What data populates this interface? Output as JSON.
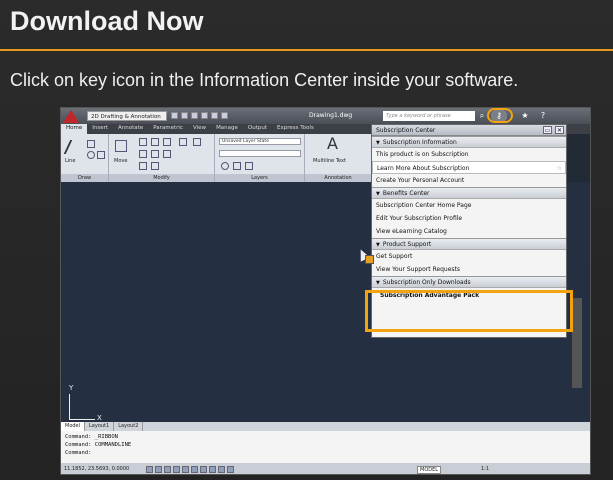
{
  "slide": {
    "title": "Download Now",
    "subtitle": "Click on key icon in the Information Center inside your software."
  },
  "autocad": {
    "workspace": "2D Drafting & Annotation",
    "document_title": "Drawing1.dwg",
    "search_placeholder": "Type a keyword or phrase",
    "tabs": [
      "Home",
      "Insert",
      "Annotate",
      "Parametric",
      "View",
      "Manage",
      "Output",
      "Express Tools"
    ],
    "active_tab": "Home",
    "ribbon": {
      "groups": [
        "Draw",
        "Modify",
        "Layers",
        "Annotation"
      ],
      "tools": [
        "Line",
        "Move"
      ],
      "layer_state": "Unsaved Layer State",
      "annotation_tool": "Multiline Text",
      "text_letter": "A"
    },
    "layout_tabs": [
      "Model",
      "Layout1",
      "Layout2"
    ],
    "command_lines": [
      "Command: _RIBBON",
      "Command: COMMANDLINE",
      "Command:"
    ],
    "status": {
      "coordinates": "11.1852, 23.5693, 0.0000",
      "model_label": "MODEL",
      "scale": "1:1"
    },
    "ucs": {
      "x": "X",
      "y": "Y"
    }
  },
  "subscription_center": {
    "title": "Subscription Center",
    "sections": [
      {
        "header": "Subscription Information",
        "items": [
          "This product is on Subscription",
          "Learn More About Subscription",
          "Create Your Personal Account"
        ]
      },
      {
        "header": "Benefits Center",
        "items": [
          "Subscription Center Home Page",
          "Edit Your Subscription Profile",
          "View eLearning Catalog"
        ]
      },
      {
        "header": "Product Support",
        "items": [
          "Get Support",
          "View Your Support Requests"
        ]
      },
      {
        "header": "Subscription Only Downloads",
        "items": [
          "Subscription Advantage Pack"
        ]
      }
    ]
  },
  "colors": {
    "accent": "#e39a1c",
    "highlight": "#f2a30f",
    "canvas": "#243042"
  },
  "icons": [
    "key-icon",
    "search-icon",
    "star-icon",
    "help-icon",
    "autocad-logo-icon"
  ]
}
